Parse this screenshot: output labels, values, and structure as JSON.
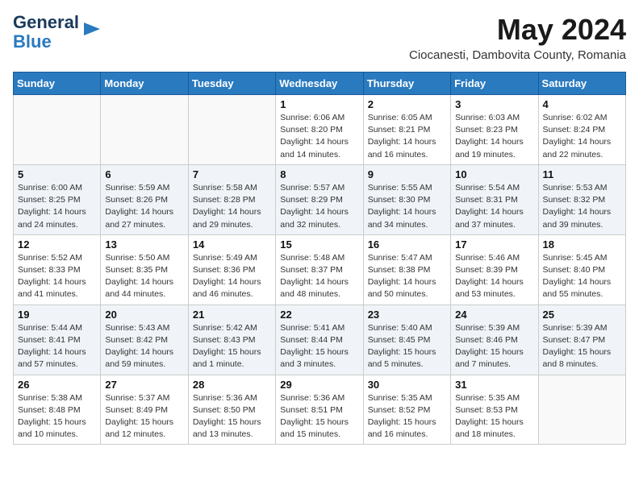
{
  "logo": {
    "line1": "General",
    "line2": "Blue"
  },
  "header": {
    "month_year": "May 2024",
    "location": "Ciocanesti, Dambovita County, Romania"
  },
  "weekdays": [
    "Sunday",
    "Monday",
    "Tuesday",
    "Wednesday",
    "Thursday",
    "Friday",
    "Saturday"
  ],
  "weeks": [
    [
      {
        "day": "",
        "info": ""
      },
      {
        "day": "",
        "info": ""
      },
      {
        "day": "",
        "info": ""
      },
      {
        "day": "1",
        "info": "Sunrise: 6:06 AM\nSunset: 8:20 PM\nDaylight: 14 hours\nand 14 minutes."
      },
      {
        "day": "2",
        "info": "Sunrise: 6:05 AM\nSunset: 8:21 PM\nDaylight: 14 hours\nand 16 minutes."
      },
      {
        "day": "3",
        "info": "Sunrise: 6:03 AM\nSunset: 8:23 PM\nDaylight: 14 hours\nand 19 minutes."
      },
      {
        "day": "4",
        "info": "Sunrise: 6:02 AM\nSunset: 8:24 PM\nDaylight: 14 hours\nand 22 minutes."
      }
    ],
    [
      {
        "day": "5",
        "info": "Sunrise: 6:00 AM\nSunset: 8:25 PM\nDaylight: 14 hours\nand 24 minutes."
      },
      {
        "day": "6",
        "info": "Sunrise: 5:59 AM\nSunset: 8:26 PM\nDaylight: 14 hours\nand 27 minutes."
      },
      {
        "day": "7",
        "info": "Sunrise: 5:58 AM\nSunset: 8:28 PM\nDaylight: 14 hours\nand 29 minutes."
      },
      {
        "day": "8",
        "info": "Sunrise: 5:57 AM\nSunset: 8:29 PM\nDaylight: 14 hours\nand 32 minutes."
      },
      {
        "day": "9",
        "info": "Sunrise: 5:55 AM\nSunset: 8:30 PM\nDaylight: 14 hours\nand 34 minutes."
      },
      {
        "day": "10",
        "info": "Sunrise: 5:54 AM\nSunset: 8:31 PM\nDaylight: 14 hours\nand 37 minutes."
      },
      {
        "day": "11",
        "info": "Sunrise: 5:53 AM\nSunset: 8:32 PM\nDaylight: 14 hours\nand 39 minutes."
      }
    ],
    [
      {
        "day": "12",
        "info": "Sunrise: 5:52 AM\nSunset: 8:33 PM\nDaylight: 14 hours\nand 41 minutes."
      },
      {
        "day": "13",
        "info": "Sunrise: 5:50 AM\nSunset: 8:35 PM\nDaylight: 14 hours\nand 44 minutes."
      },
      {
        "day": "14",
        "info": "Sunrise: 5:49 AM\nSunset: 8:36 PM\nDaylight: 14 hours\nand 46 minutes."
      },
      {
        "day": "15",
        "info": "Sunrise: 5:48 AM\nSunset: 8:37 PM\nDaylight: 14 hours\nand 48 minutes."
      },
      {
        "day": "16",
        "info": "Sunrise: 5:47 AM\nSunset: 8:38 PM\nDaylight: 14 hours\nand 50 minutes."
      },
      {
        "day": "17",
        "info": "Sunrise: 5:46 AM\nSunset: 8:39 PM\nDaylight: 14 hours\nand 53 minutes."
      },
      {
        "day": "18",
        "info": "Sunrise: 5:45 AM\nSunset: 8:40 PM\nDaylight: 14 hours\nand 55 minutes."
      }
    ],
    [
      {
        "day": "19",
        "info": "Sunrise: 5:44 AM\nSunset: 8:41 PM\nDaylight: 14 hours\nand 57 minutes."
      },
      {
        "day": "20",
        "info": "Sunrise: 5:43 AM\nSunset: 8:42 PM\nDaylight: 14 hours\nand 59 minutes."
      },
      {
        "day": "21",
        "info": "Sunrise: 5:42 AM\nSunset: 8:43 PM\nDaylight: 15 hours\nand 1 minute."
      },
      {
        "day": "22",
        "info": "Sunrise: 5:41 AM\nSunset: 8:44 PM\nDaylight: 15 hours\nand 3 minutes."
      },
      {
        "day": "23",
        "info": "Sunrise: 5:40 AM\nSunset: 8:45 PM\nDaylight: 15 hours\nand 5 minutes."
      },
      {
        "day": "24",
        "info": "Sunrise: 5:39 AM\nSunset: 8:46 PM\nDaylight: 15 hours\nand 7 minutes."
      },
      {
        "day": "25",
        "info": "Sunrise: 5:39 AM\nSunset: 8:47 PM\nDaylight: 15 hours\nand 8 minutes."
      }
    ],
    [
      {
        "day": "26",
        "info": "Sunrise: 5:38 AM\nSunset: 8:48 PM\nDaylight: 15 hours\nand 10 minutes."
      },
      {
        "day": "27",
        "info": "Sunrise: 5:37 AM\nSunset: 8:49 PM\nDaylight: 15 hours\nand 12 minutes."
      },
      {
        "day": "28",
        "info": "Sunrise: 5:36 AM\nSunset: 8:50 PM\nDaylight: 15 hours\nand 13 minutes."
      },
      {
        "day": "29",
        "info": "Sunrise: 5:36 AM\nSunset: 8:51 PM\nDaylight: 15 hours\nand 15 minutes."
      },
      {
        "day": "30",
        "info": "Sunrise: 5:35 AM\nSunset: 8:52 PM\nDaylight: 15 hours\nand 16 minutes."
      },
      {
        "day": "31",
        "info": "Sunrise: 5:35 AM\nSunset: 8:53 PM\nDaylight: 15 hours\nand 18 minutes."
      },
      {
        "day": "",
        "info": ""
      }
    ]
  ]
}
